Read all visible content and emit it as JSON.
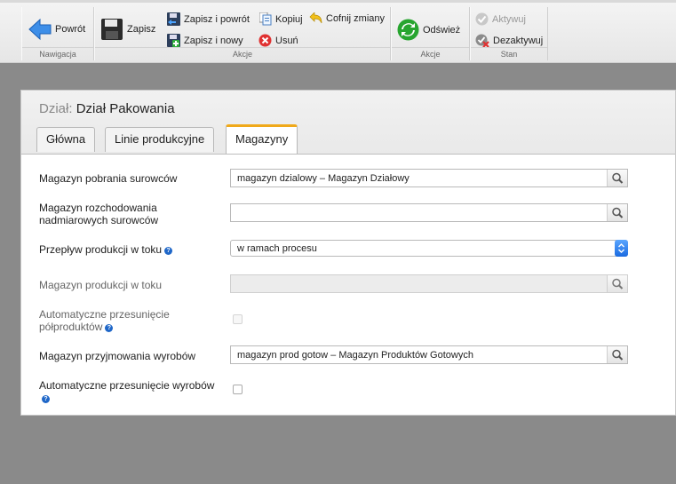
{
  "toolbar": {
    "groups": {
      "navigation": "Nawigacja",
      "actions": "Akcje",
      "actions2": "Akcje",
      "state": "Stan"
    },
    "back": "Powrót",
    "save": "Zapisz",
    "save_and_back": "Zapisz i powrót",
    "save_and_new": "Zapisz i nowy",
    "copy": "Kopiuj",
    "delete": "Usuń",
    "undo_changes": "Cofnij zmiany",
    "refresh": "Odśwież",
    "activate": "Aktywuj",
    "deactivate": "Dezaktywuj"
  },
  "form": {
    "title_prefix": "Dział:",
    "title": "Dział Pakowania",
    "tabs": [
      "Główna",
      "Linie produkcyjne",
      "Magazyny"
    ],
    "active_tab": "Magazyny",
    "fields": {
      "raw_material_warehouse": {
        "label": "Magazyn pobrania surowców",
        "value": "magazyn dzialowy – Magazyn Działowy"
      },
      "surplus_warehouse": {
        "label_line1": "Magazyn rozchodowania",
        "label_line2": "nadmiarowych surowców",
        "value": ""
      },
      "production_flow": {
        "label": "Przepływ produkcji w toku",
        "value": "w ramach procesu"
      },
      "wip_warehouse": {
        "label": "Magazyn produkcji w toku",
        "value": ""
      },
      "auto_move_semi": {
        "label_line1": "Automatyczne przesunięcie",
        "label_line2": "półproduktów",
        "checked": false
      },
      "finished_goods_warehouse": {
        "label": "Magazyn przyjmowania wyrobów",
        "value": "magazyn prod gotow – Magazyn Produktów Gotowych"
      },
      "auto_move_products": {
        "label": "Automatyczne przesunięcie wyrobów",
        "checked": false
      }
    }
  },
  "colors": {
    "accent_tab": "#f0a91a",
    "help_icon": "#1f67c8",
    "select_button": "#1a6ae0",
    "page_background": "#8a8a8a"
  },
  "icons": [
    "arrow-left-icon",
    "floppy-disk-icon",
    "save-and-back-icon",
    "save-and-new-icon",
    "copy-icon",
    "delete-icon",
    "undo-icon",
    "refresh-icon",
    "activate-icon",
    "deactivate-icon",
    "search-icon",
    "help-icon"
  ]
}
